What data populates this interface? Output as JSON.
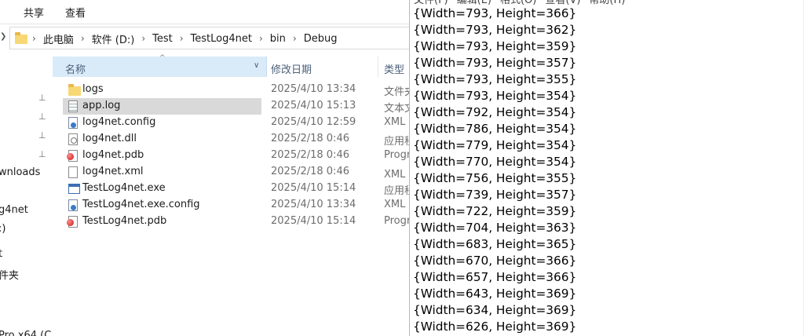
{
  "explorer": {
    "ribbon_tabs": [
      "共享",
      "查看"
    ],
    "breadcrumb": [
      "此电脑",
      "软件 (D:)",
      "Test",
      "TestLog4net",
      "bin",
      "Debug"
    ],
    "nav_items": [
      "wnloads",
      "g4net",
      ":)",
      "t",
      "件夹",
      "Pro x64 (C"
    ],
    "columns": {
      "name": "名称",
      "date": "修改日期",
      "type": "类型"
    },
    "files": [
      {
        "name": "logs",
        "date": "2025/4/10 13:34",
        "type": "文件夹",
        "icon": "folder-icon"
      },
      {
        "name": "app.log",
        "date": "2025/4/10 15:13",
        "type": "文本文",
        "icon": "text-file-icon",
        "selected": true
      },
      {
        "name": "log4net.config",
        "date": "2025/4/10 12:59",
        "type": "XML C",
        "icon": "config-file-icon"
      },
      {
        "name": "log4net.dll",
        "date": "2025/2/18 0:46",
        "type": "应用程",
        "icon": "dll-file-icon"
      },
      {
        "name": "log4net.pdb",
        "date": "2025/2/18 0:46",
        "type": "Progr",
        "icon": "pdb-file-icon"
      },
      {
        "name": "log4net.xml",
        "date": "2025/2/18 0:46",
        "type": "XML 文",
        "icon": "xml-file-icon"
      },
      {
        "name": "TestLog4net.exe",
        "date": "2025/4/10 15:14",
        "type": "应用程",
        "icon": "exe-file-icon"
      },
      {
        "name": "TestLog4net.exe.config",
        "date": "2025/4/10 13:34",
        "type": "XML C",
        "icon": "config-file-icon"
      },
      {
        "name": "TestLog4net.pdb",
        "date": "2025/4/10 15:14",
        "type": "Progr",
        "icon": "pdb-file-icon"
      }
    ]
  },
  "notepad": {
    "menu": [
      "文件(F)",
      "编辑(E)",
      "格式(O)",
      "查看(V)",
      "帮助(H)"
    ],
    "lines": [
      "{Width=793, Height=366}",
      "{Width=793, Height=362}",
      "{Width=793, Height=359}",
      "{Width=793, Height=357}",
      "{Width=793, Height=355}",
      "{Width=793, Height=354}",
      "{Width=792, Height=354}",
      "{Width=786, Height=354}",
      "{Width=779, Height=354}",
      "{Width=770, Height=354}",
      "{Width=756, Height=355}",
      "{Width=739, Height=357}",
      "{Width=722, Height=359}",
      "{Width=704, Height=363}",
      "{Width=683, Height=365}",
      "{Width=670, Height=366}",
      "{Width=657, Height=366}",
      "{Width=643, Height=369}",
      "{Width=634, Height=369}",
      "{Width=626, Height=369}"
    ]
  }
}
